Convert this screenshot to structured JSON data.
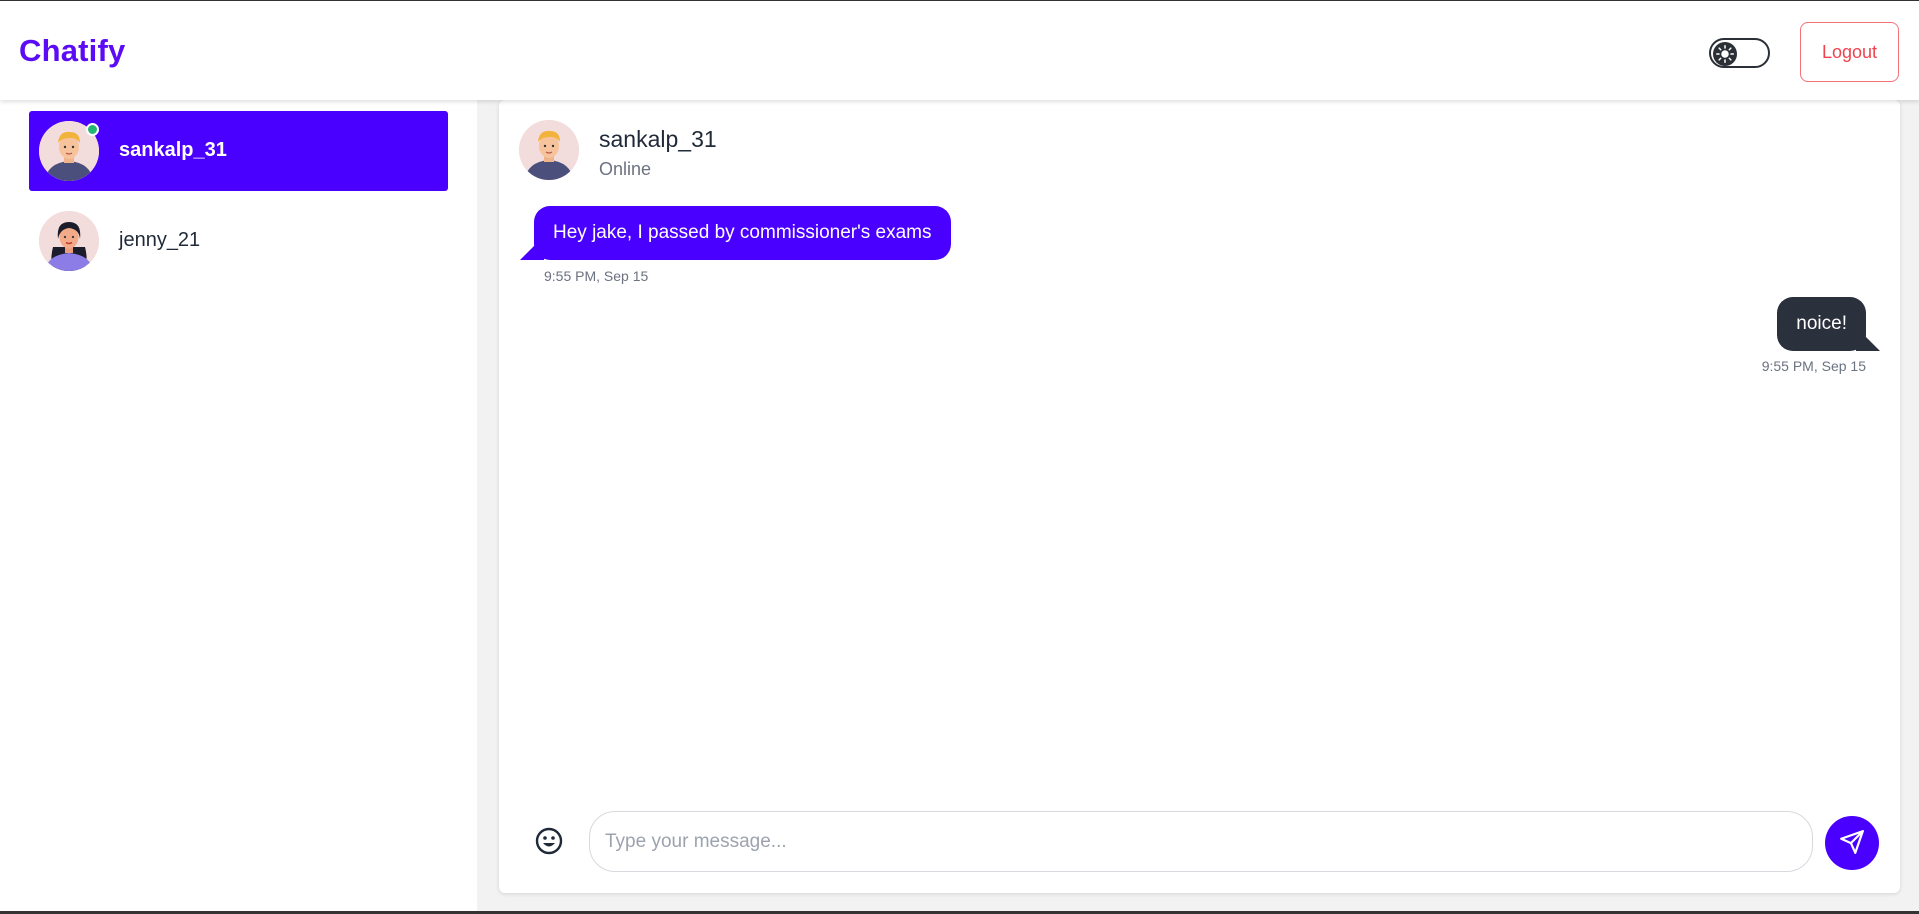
{
  "app": {
    "title": "Chatify"
  },
  "header": {
    "logout_label": "Logout",
    "theme_icon": "sun-icon"
  },
  "colors": {
    "brand": "#5b0cf5",
    "accent": "#4a00ff",
    "logout": "#f0434e",
    "online": "#22b573",
    "outgoing_bubble": "#2a303c"
  },
  "sidebar": {
    "contacts": [
      {
        "name": "sankalp_31",
        "online": true,
        "active": true,
        "avatar": "male-avatar"
      },
      {
        "name": "jenny_21",
        "online": false,
        "active": false,
        "avatar": "female-avatar"
      }
    ]
  },
  "chat": {
    "title": "sankalp_31",
    "status": "Online",
    "messages": [
      {
        "direction": "incoming",
        "text": "Hey jake, I passed by commissioner's exams",
        "time": "9:55 PM, Sep 15"
      },
      {
        "direction": "outgoing",
        "text": "noice!",
        "time": "9:55 PM, Sep 15"
      }
    ]
  },
  "composer": {
    "placeholder": "Type your message...",
    "emoji_icon": "smile-icon",
    "send_icon": "send-icon"
  }
}
